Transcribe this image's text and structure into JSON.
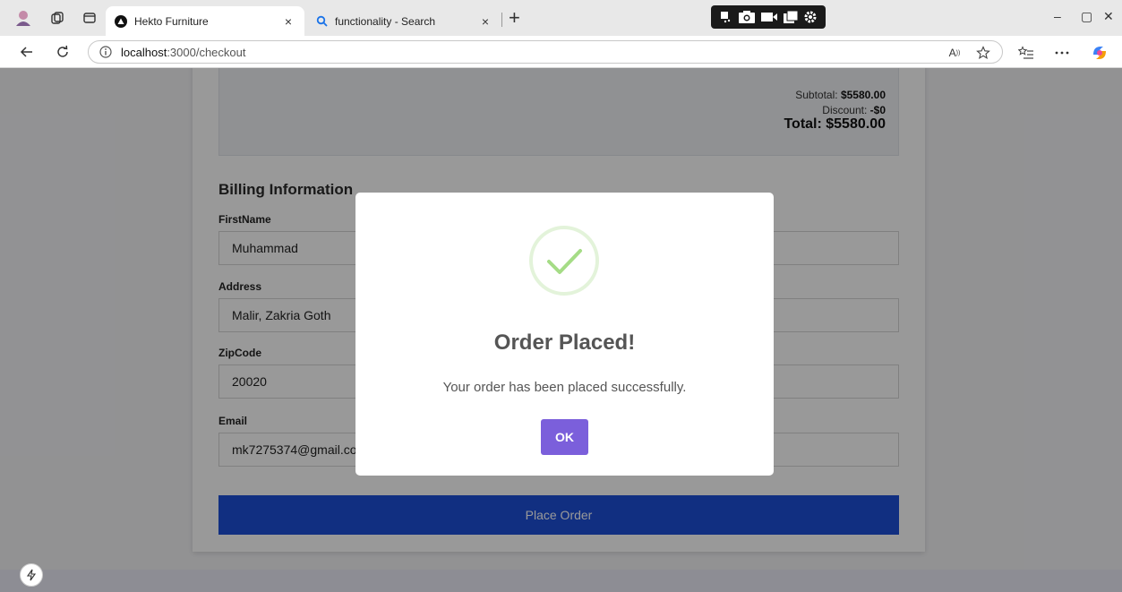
{
  "browser": {
    "tabs": [
      {
        "title": "Hekto Furniture",
        "close": "×"
      },
      {
        "title": "functionality - Search",
        "close": "×"
      }
    ],
    "new_tab": "+",
    "url_host": "localhost",
    "url_path": ":3000/checkout",
    "window_controls": [
      "–",
      "▢",
      "✕"
    ],
    "toolbar_icons": [
      "read-aloud-icon",
      "favorite-star-icon",
      "favorites-list-icon",
      "more-icon",
      "copilot-icon"
    ]
  },
  "checkout": {
    "subtotal_label": "Subtotal: ",
    "subtotal_value": "$5580.00",
    "discount_label": "Discount: ",
    "discount_value": "-$0",
    "total": "Total: $5580.00",
    "billing_title": "Billing Information",
    "fields": [
      {
        "label": "FirstName",
        "value": "Muhammad"
      },
      {
        "label": "Address",
        "value": "Malir, Zakria Goth"
      },
      {
        "label": "ZipCode",
        "value": "20020"
      },
      {
        "label": "Email",
        "value": "mk7275374@gmail.com"
      }
    ],
    "place_order": "Place Order"
  },
  "modal": {
    "title": "Order Placed!",
    "message": "Your order has been placed successfully.",
    "ok": "OK",
    "icon": "success-check-icon",
    "accent": "#a5dc86",
    "button_color": "#7b5fdb"
  },
  "colors": {
    "place_order_button": "#1d4fd8"
  }
}
